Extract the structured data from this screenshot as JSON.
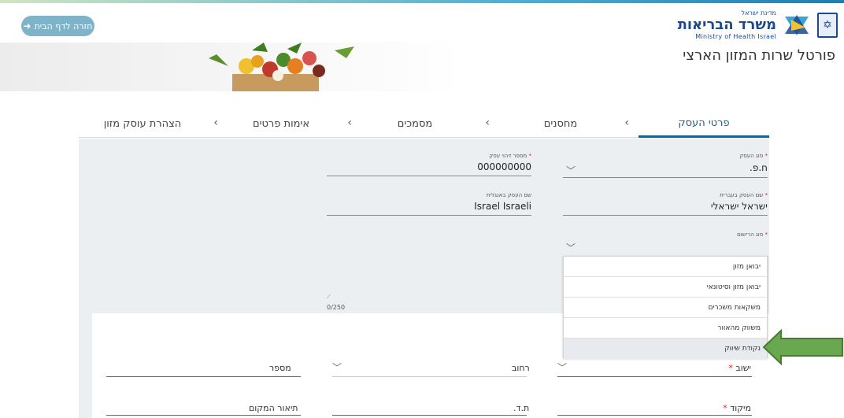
{
  "header": {
    "home_button": "חזרה לדף הבית",
    "logo_top": "מדינת ישראל",
    "logo_main": "משרד הבריאות",
    "logo_english": "Ministry of Health Israel"
  },
  "banner": {
    "title": "פורטל שרות המזון הארצי"
  },
  "tabs": [
    {
      "label": "פרטי העסק",
      "active": true
    },
    {
      "label": "מחסנים",
      "active": false
    },
    {
      "label": "מסמכים",
      "active": false
    },
    {
      "label": "אימות פרטים",
      "active": false
    },
    {
      "label": "הצהרת עוסק מזון",
      "active": false
    }
  ],
  "form": {
    "business_type": {
      "label": "סוג העסק",
      "value": "ח.פ."
    },
    "business_id": {
      "label": "מספר זיהוי עסק",
      "value": "000000000"
    },
    "name_hebrew": {
      "label": "שם העסק בעברית",
      "value": "ישראל ישראלי"
    },
    "name_english": {
      "label": "שם העסק באנגלית",
      "value": "Israel Israeli"
    },
    "registration_type": {
      "label": "סוג הרישום",
      "value": ""
    },
    "char_counter": "0/250"
  },
  "dropdown": {
    "options": [
      "יבואן מזון",
      "יבואן מזון וסיטונאי",
      "משקאות משכרים",
      "משווק מהאוור",
      "נקודת שיווק"
    ],
    "hovered_index": 4
  },
  "address": {
    "city_label": "ישוב",
    "street_label": "רחוב",
    "number_label": "מספר",
    "zip_label": "מיקוד",
    "pobox_label": "ת.ד.",
    "location_desc_label": "תיאור המקום"
  },
  "colors": {
    "accent": "#1d5f8a",
    "arrow_green": "#6aa84f",
    "panel_bg": "#eceff2"
  }
}
